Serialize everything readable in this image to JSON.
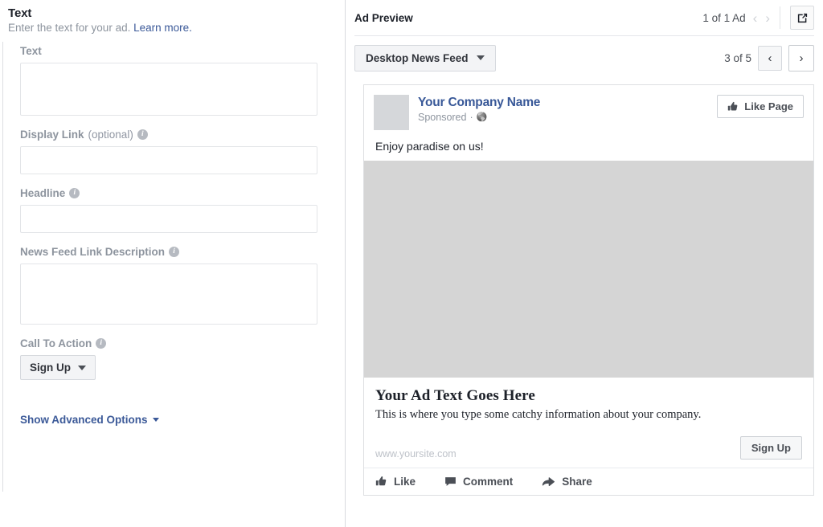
{
  "left": {
    "section_title": "Text",
    "section_subtitle": "Enter the text for your ad.",
    "learn_more": "Learn more.",
    "fields": {
      "text": {
        "label": "Text",
        "value": ""
      },
      "display_link": {
        "label": "Display Link",
        "optional": "(optional)",
        "value": ""
      },
      "headline": {
        "label": "Headline",
        "value": ""
      },
      "news_feed_link_description": {
        "label": "News Feed Link Description",
        "value": ""
      },
      "call_to_action": {
        "label": "Call To Action",
        "value": "Sign Up"
      }
    },
    "advanced_options": "Show Advanced Options"
  },
  "preview": {
    "title": "Ad Preview",
    "ad_count": "1 of 1 Ad",
    "placement": "Desktop News Feed",
    "page_count": "3 of 5"
  },
  "post": {
    "page_name": "Your Company Name",
    "sponsored": "Sponsored",
    "like_page": "Like Page",
    "body_text": "Enjoy paradise on us!",
    "link_title": "Your Ad Text Goes Here",
    "link_description": "This is where you type some catchy information about your company.",
    "link_url": "www.yoursite.com",
    "cta_button": "Sign Up",
    "actions": {
      "like": "Like",
      "comment": "Comment",
      "share": "Share"
    }
  },
  "colors": {
    "fb_blue": "#3b5998",
    "link_blue": "#385898",
    "label_grey": "#8d949e",
    "image_placeholder": "#d5d5d5"
  }
}
